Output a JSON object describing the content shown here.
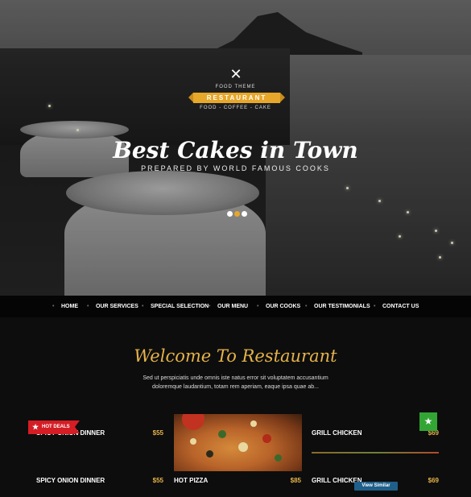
{
  "hero": {
    "logo_icon": "crossed-utensils-icon",
    "food_theme": "FOOD THEME",
    "brand": "RESTAURANT",
    "tagline": "FOOD  -  COFFEE  -  CAKE",
    "title": "Best Cakes in Town",
    "subtitle": "PREPARED BY WORLD FAMOUS COOKS",
    "slides_total": 3,
    "slide_active": 2
  },
  "nav": {
    "items": [
      "HOME",
      "OUR SERVICES",
      "SPECIAL SELECTION",
      "OUR MENU",
      "OUR COOKS",
      "OUR TESTIMONIALS",
      "CONTACT US"
    ]
  },
  "welcome": {
    "title": "Welcome To Restaurant",
    "text": "Sed ut perspiciatis unde omnis iste natus error sit voluptatem accusantium doloremque laudantium, totam rem aperiam, eaque ipsa quae ab..."
  },
  "menu": {
    "items": [
      {
        "name": "SPICY ONION DINNER",
        "price": "$55"
      },
      {
        "name": "GRILL CHICKEN",
        "price": "$69"
      },
      {
        "name": "SPICY ONION DINNER",
        "price": "$55"
      },
      {
        "name": "HOT PIZZA",
        "price": "$85"
      },
      {
        "name": "GRILL CHICKEN",
        "price": "$69"
      }
    ]
  },
  "overlay": {
    "hot_deals": "HOT DEALS",
    "hot_deals_icon": "star-icon",
    "green_badge_icon": "star-icon",
    "view_similar": "View Similar"
  },
  "colors": {
    "accent": "#e6a72a",
    "gold_text": "#e6b34a",
    "hot_deals": "#d41d24",
    "badge_green": "#33a534",
    "view_similar": "#1f5f8a"
  }
}
